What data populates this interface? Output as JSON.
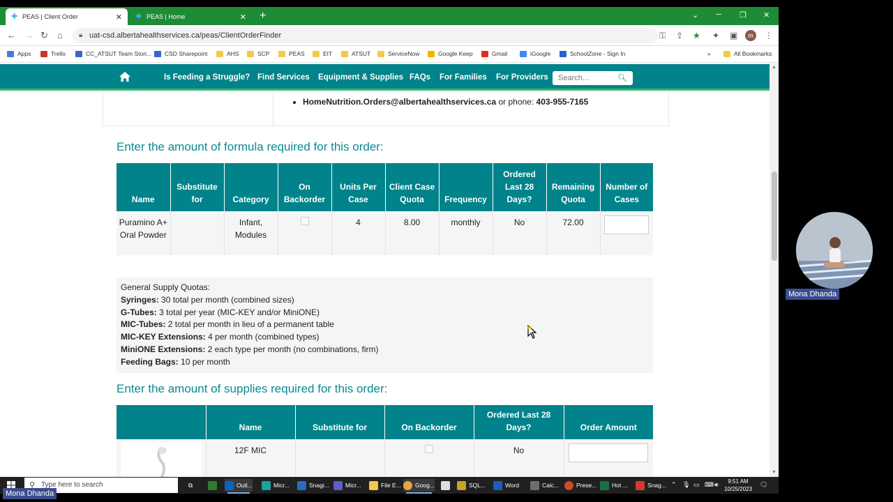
{
  "browser": {
    "tabs": [
      {
        "title": "PEAS | Client Order",
        "active": true
      },
      {
        "title": "PEAS | Home",
        "active": false
      }
    ],
    "url": "uat-csd.albertahealthservices.ca/peas/ClientOrderFinder",
    "profile_initial": "m",
    "bookmarks": [
      "Apps",
      "Trello",
      "CC_ATSUT Team Stori...",
      "CSD Sharepoint",
      "AHS",
      "SCP",
      "PEAS",
      "EIT",
      "ATSUT",
      "ServiceNow",
      "Google Keep",
      "Gmail",
      "iGoogle",
      "SchoolZone - Sign In",
      "»",
      "All Bookmarks"
    ]
  },
  "site_nav": {
    "links": [
      "Is Feeding a Struggle?",
      "Find Services",
      "Equipment & Supplies",
      "FAQs",
      "For Families",
      "For Providers"
    ],
    "search_placeholder": "Search..."
  },
  "contact": {
    "email": "HomeNutrition.Orders@albertahealthservices.ca",
    "or_phone": " or phone: ",
    "phone": "403-955-7165"
  },
  "formula": {
    "title": "Enter the amount of formula required for this order:",
    "headers": [
      "Name",
      "Substitute for",
      "Category",
      "On Backorder",
      "Units Per Case",
      "Client Case Quota",
      "Frequency",
      "Ordered Last 28 Days?",
      "Remaining Quota",
      "Number of Cases"
    ],
    "row": {
      "name": "Puramino A+ Oral Powder",
      "substitute_for": "",
      "category": "Infant, Modules",
      "on_backorder": false,
      "units_per_case": "4",
      "client_case_quota": "8.00",
      "frequency": "monthly",
      "ordered_last_28": "No",
      "remaining_quota": "72.00",
      "number_of_cases": ""
    }
  },
  "quotas": {
    "heading": "General Supply Quotas:",
    "items": [
      {
        "label": "Syringes:",
        "text": " 30 total per month (combined sizes)"
      },
      {
        "label": "G-Tubes:",
        "text": " 3 total per year (MIC-KEY and/or MiniONE)"
      },
      {
        "label": "MIC-Tubes:",
        "text": " 2 total per month in lieu of a permanent table"
      },
      {
        "label": "MIC-KEY Extensions:",
        "text": " 4 per month (combined types)"
      },
      {
        "label": "MiniONE Extensions:",
        "text": " 2 each type per month (no combinations, firm)"
      },
      {
        "label": "Feeding Bags:",
        "text": " 10 per month"
      }
    ]
  },
  "supplies": {
    "title": "Enter the amount of supplies required for this order:",
    "headers": [
      "",
      "Name",
      "Substitute for",
      "On Backorder",
      "Ordered Last 28 Days?",
      "Order Amount"
    ],
    "row": {
      "name": "12F MIC",
      "substitute_for": "",
      "on_backorder": false,
      "ordered_last_28": "No",
      "order_amount": ""
    }
  },
  "webcam": {
    "name": "Mona Dhanda"
  },
  "taskbar": {
    "search_placeholder": "Type here to search",
    "apps": [
      "Outl...",
      "Micr...",
      "Snagi...",
      "Micr...",
      "File E...",
      "Goog...",
      "SQL...",
      "Word",
      "Calc...",
      "Prese...",
      "Hot ...",
      "Snag..."
    ],
    "time": "9:51 AM",
    "date": "10/25/2023"
  },
  "colors": {
    "brand_teal": "#00838a",
    "brand_green": "#1e8b36",
    "accent_green": "#3fb56a"
  }
}
